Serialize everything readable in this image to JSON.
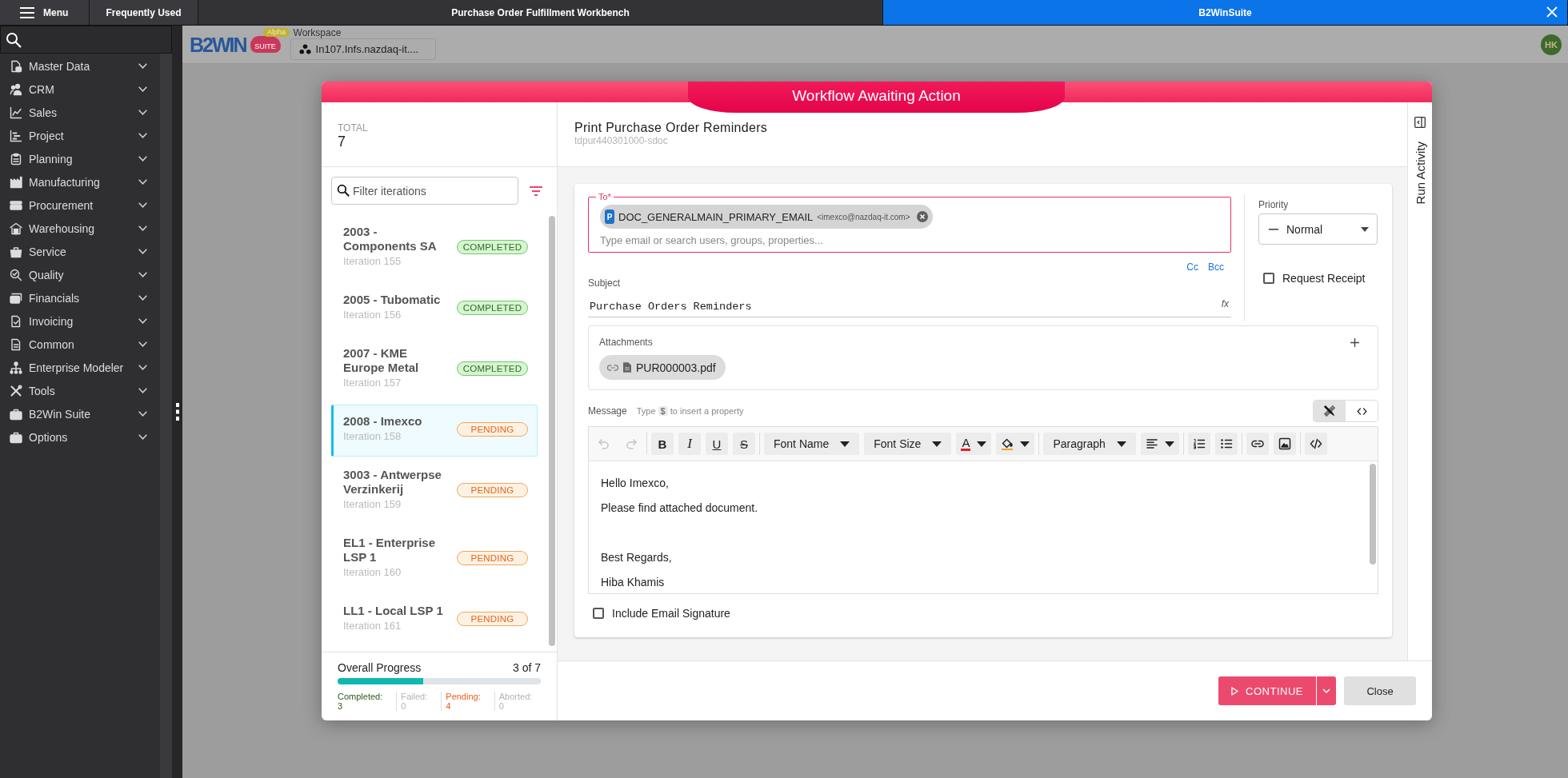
{
  "top_tabs": [
    {
      "label": "Menu",
      "kind": "menu",
      "selected": false
    },
    {
      "label": "Frequently Used",
      "kind": "shortcut",
      "selected": false
    },
    {
      "label": "Purchase Order Fulfillment Workbench",
      "kind": "window",
      "selected": false
    },
    {
      "label": "B2WinSuite",
      "kind": "window",
      "selected": true
    }
  ],
  "sidebar": {
    "items": [
      {
        "label": "Master Data",
        "expanded": false
      },
      {
        "label": "CRM",
        "expanded": false
      },
      {
        "label": "Sales",
        "expanded": false
      },
      {
        "label": "Project",
        "expanded": false
      },
      {
        "label": "Planning",
        "expanded": false
      },
      {
        "label": "Manufacturing",
        "expanded": false
      },
      {
        "label": "Procurement",
        "expanded": false
      },
      {
        "label": "Warehousing",
        "expanded": false
      },
      {
        "label": "Service",
        "expanded": false
      },
      {
        "label": "Quality",
        "expanded": false
      },
      {
        "label": "Financials",
        "expanded": false
      },
      {
        "label": "Invoicing",
        "expanded": false
      },
      {
        "label": "Common",
        "expanded": false
      },
      {
        "label": "Enterprise Modeler",
        "expanded": false
      },
      {
        "label": "Tools",
        "expanded": false
      },
      {
        "label": "B2Win Suite",
        "expanded": false
      },
      {
        "label": "Options",
        "expanded": false
      }
    ]
  },
  "app_header": {
    "logo": {
      "wordmark": "B2WIN",
      "suite": "SUITE",
      "badge": "Alpha"
    },
    "workspace": {
      "label": "Workspace",
      "value": "In107.Infs.nazdaq-it...."
    },
    "avatar": "HK"
  },
  "dialog": {
    "title": "Workflow Awaiting Action",
    "iterations": {
      "total_label": "TOTAL",
      "total": "7",
      "filter": {
        "placeholder": "Filter iterations"
      },
      "items": [
        {
          "title": "2003 - Components SA",
          "subtitle": "Iteration 155",
          "status": "COMPLETED",
          "kind": "completed",
          "selected": false
        },
        {
          "title": "2005 - Tubomatic",
          "subtitle": "Iteration 156",
          "status": "COMPLETED",
          "kind": "completed",
          "selected": false
        },
        {
          "title": "2007 - KME Europe Metal",
          "subtitle": "Iteration 157",
          "status": "COMPLETED",
          "kind": "completed",
          "selected": false
        },
        {
          "title": "2008 - Imexco",
          "subtitle": "Iteration 158",
          "status": "PENDING",
          "kind": "pending",
          "selected": true
        },
        {
          "title": "3003 - Antwerpse Verzinkerij",
          "subtitle": "Iteration 159",
          "status": "PENDING",
          "kind": "pending",
          "selected": false
        },
        {
          "title": "EL1 - Enterprise LSP 1",
          "subtitle": "Iteration 160",
          "status": "PENDING",
          "kind": "pending",
          "selected": false
        },
        {
          "title": "LL1 - Local LSP 1",
          "subtitle": "Iteration 161",
          "status": "PENDING",
          "kind": "pending",
          "selected": false
        }
      ],
      "progress": {
        "label": "Overall Progress",
        "reading": "3 of 7",
        "level": 0.42,
        "stats": [
          {
            "label": "Completed:",
            "value": "3",
            "kind": "completed"
          },
          {
            "label": "Failed:",
            "value": "0",
            "kind": "failed"
          },
          {
            "label": "Pending:",
            "value": "4",
            "kind": "pending"
          },
          {
            "label": "Aborted:",
            "value": "0",
            "kind": "aborted"
          }
        ]
      }
    },
    "activity": {
      "title": "Print Purchase Order Reminders",
      "subtitle": "tdpur440301000-sdoc"
    },
    "email": {
      "to": {
        "label": "To*",
        "recipients": [
          {
            "badge": "P",
            "name": "DOC_GENERALMAIN_PRIMARY_EMAIL",
            "address": "<imexco@nazdaq-it.com>"
          }
        ],
        "placeholder": "Type email or search users, groups, properties..."
      },
      "cc": "Cc",
      "bcc": "Bcc",
      "subject": {
        "label": "Subject",
        "value": "Purchase Orders Reminders",
        "function_button": "fx"
      },
      "priority": {
        "label": "Priority",
        "value": "Normal"
      },
      "request_receipt": {
        "label": "Request Receipt",
        "checked": false
      },
      "attachments": {
        "label": "Attachments",
        "files": [
          {
            "name": "PUR000003.pdf"
          }
        ]
      },
      "message": {
        "label": "Message",
        "hint": {
          "before": "Type",
          "key": "$",
          "after": "to insert a property"
        },
        "modes": [
          {
            "kind": "visual",
            "selected": true
          },
          {
            "kind": "source",
            "selected": false
          }
        ],
        "toolbar": [
          {
            "items": [
              {
                "kind": "undo",
                "disabled": true
              },
              {
                "kind": "redo",
                "disabled": true
              }
            ]
          },
          {
            "items": [
              {
                "kind": "bold",
                "label": "B",
                "disabled": false
              },
              {
                "kind": "italic",
                "label": "I",
                "disabled": false
              },
              {
                "kind": "underline",
                "label": "U",
                "disabled": false
              },
              {
                "kind": "strike",
                "label": "S",
                "disabled": false
              }
            ]
          },
          {
            "items": [
              {
                "kind": "dropdown",
                "label": "Font Name",
                "disabled": false
              },
              {
                "kind": "dropdown",
                "label": "Font Size",
                "disabled": false
              },
              {
                "kind": "text-color",
                "label": "A",
                "disabled": false
              },
              {
                "kind": "highlight",
                "disabled": false
              }
            ]
          },
          {
            "items": [
              {
                "kind": "dropdown",
                "label": "Paragraph",
                "disabled": false
              },
              {
                "kind": "align",
                "disabled": false
              }
            ]
          },
          {
            "items": [
              {
                "kind": "ordered-list",
                "disabled": false
              },
              {
                "kind": "bullet-list",
                "disabled": false
              }
            ]
          },
          {
            "items": [
              {
                "kind": "link",
                "disabled": false
              },
              {
                "kind": "image",
                "disabled": false
              }
            ]
          },
          {
            "items": [
              {
                "kind": "code",
                "disabled": false
              }
            ]
          }
        ],
        "body": [
          {
            "lines": [
              "Hello Imexco,",
              "Please find attached document."
            ]
          },
          {
            "lines": [
              "Best Regards,",
              "Hiba Khamis"
            ]
          }
        ]
      },
      "include_signature": {
        "label": "Include Email Signature",
        "checked": false
      }
    },
    "side_panel": {
      "label": "Run Activity"
    },
    "footer": {
      "buttons": [
        {
          "label": "CONTINUE",
          "kind": "primary"
        },
        {
          "label": "Close",
          "kind": "secondary"
        }
      ]
    }
  }
}
